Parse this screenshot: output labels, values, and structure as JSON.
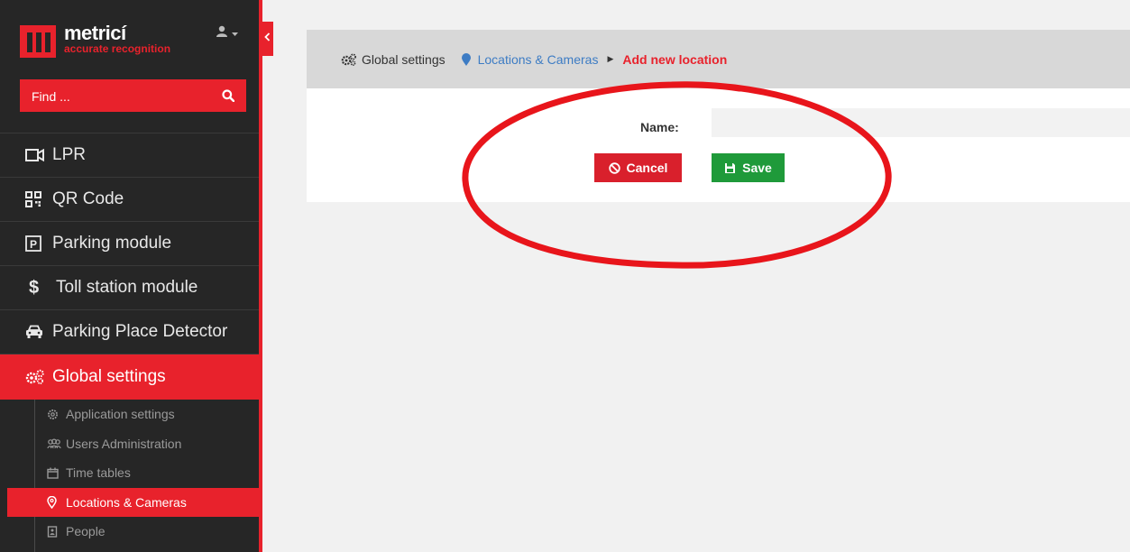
{
  "brand": {
    "name": "metricí",
    "tagline": "accurate recognition",
    "color": "#e8222c"
  },
  "search": {
    "placeholder": "Find ..."
  },
  "nav": [
    {
      "label": "LPR",
      "icon": "video-camera-icon"
    },
    {
      "label": "QR Code",
      "icon": "qr-code-icon"
    },
    {
      "label": "Parking module",
      "icon": "parking-icon"
    },
    {
      "label": "Toll station module",
      "icon": "dollar-icon"
    },
    {
      "label": "Parking Place Detector",
      "icon": "car-icon"
    },
    {
      "label": "Global settings",
      "icon": "cogs-icon",
      "active": true
    }
  ],
  "subnav": [
    {
      "label": "Application settings",
      "icon": "gear-icon"
    },
    {
      "label": "Users Administration",
      "icon": "users-icon"
    },
    {
      "label": "Time tables",
      "icon": "calendar-icon"
    },
    {
      "label": "Locations & Cameras",
      "icon": "map-pin-icon",
      "active": true
    },
    {
      "label": "People",
      "icon": "address-book-icon"
    }
  ],
  "breadcrumb": [
    {
      "label": "Global settings",
      "icon": "cogs-icon"
    },
    {
      "label": "Locations & Cameras",
      "icon": "map-marker-icon"
    },
    {
      "label": "Add new location"
    }
  ],
  "form": {
    "name_label": "Name:",
    "name_value": "",
    "cancel_label": "Cancel",
    "save_label": "Save"
  }
}
